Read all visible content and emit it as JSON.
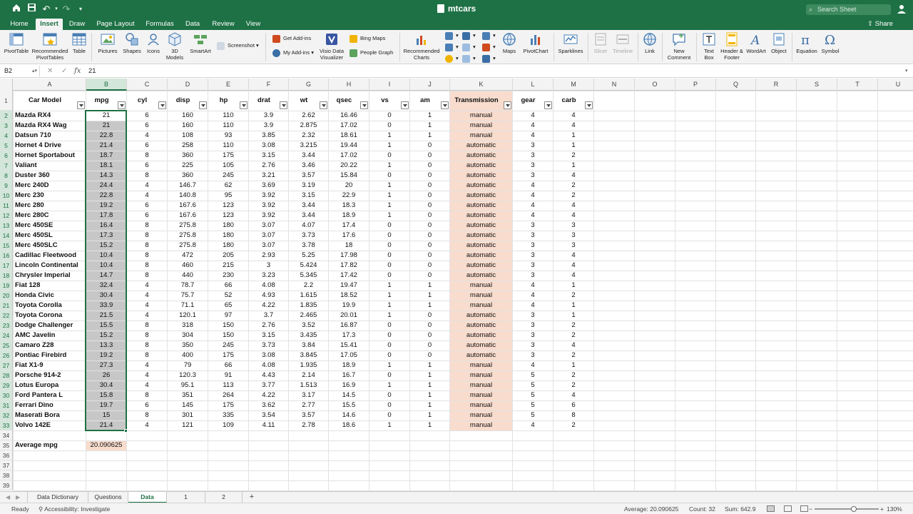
{
  "title_bar": {
    "document_title": "mtcars",
    "search_placeholder": "Search Sheet",
    "icons": [
      "home-icon",
      "save-icon",
      "undo-icon",
      "redo-icon",
      "customize-icon",
      "file-icon",
      "profile-icon"
    ]
  },
  "menu": {
    "tabs": [
      "Home",
      "Insert",
      "Draw",
      "Page Layout",
      "Formulas",
      "Data",
      "Review",
      "View"
    ],
    "active_tab": "Insert",
    "share_label": "Share"
  },
  "ribbon": {
    "pivot_table": "PivotTable",
    "recommended_pivot_1": "Recommended",
    "recommended_pivot_2": "PivotTables",
    "table": "Table",
    "pictures": "Pictures",
    "shapes": "Shapes",
    "icons": "Icons",
    "models_1": "3D",
    "models_2": "Models",
    "smartart": "SmartArt",
    "screenshot": "Screenshot",
    "get_addins": "Get Add-ins",
    "my_addins": "My Add-ins",
    "visio_1": "Visio Data",
    "visio_2": "Visualizer",
    "bing_maps": "Bing Maps",
    "people_graph": "People Graph",
    "rec_charts_1": "Recommended",
    "rec_charts_2": "Charts",
    "maps": "Maps",
    "pivot_chart": "PivotChart",
    "sparklines": "Sparklines",
    "slicer": "Slicer",
    "timeline": "Timeline",
    "link": "Link",
    "new_comment_1": "New",
    "new_comment_2": "Comment",
    "text_box_1": "Text",
    "text_box_2": "Box",
    "header_footer_1": "Header &",
    "header_footer_2": "Footer",
    "wordart": "WordArt",
    "object": "Object",
    "equation": "Equation",
    "symbol": "Symbol"
  },
  "formula_bar": {
    "name_box": "B2",
    "fx_label": "fx",
    "formula": "21"
  },
  "grid": {
    "column_letters": [
      "A",
      "B",
      "C",
      "D",
      "E",
      "F",
      "G",
      "H",
      "I",
      "J",
      "K",
      "L",
      "M",
      "N",
      "O",
      "P",
      "Q",
      "R",
      "S",
      "T",
      "U"
    ],
    "row_numbers": [
      "1",
      "2",
      "3",
      "4",
      "5",
      "6",
      "7",
      "8",
      "9",
      "10",
      "11",
      "12",
      "13",
      "14",
      "15",
      "16",
      "17",
      "18",
      "19",
      "20",
      "21",
      "22",
      "23",
      "24",
      "25",
      "26",
      "27",
      "28",
      "29",
      "30",
      "31",
      "32",
      "33",
      "34",
      "35",
      "36",
      "37",
      "38",
      "39"
    ],
    "headers": [
      "Car Model",
      "mpg",
      "cyl",
      "disp",
      "hp",
      "drat",
      "wt",
      "qsec",
      "vs",
      "am",
      "Transmission",
      "gear",
      "carb"
    ],
    "rows": [
      [
        "Mazda RX4",
        "21",
        "6",
        "160",
        "110",
        "3.9",
        "2.62",
        "16.46",
        "0",
        "1",
        "manual",
        "4",
        "4"
      ],
      [
        "Mazda RX4 Wag",
        "21",
        "6",
        "160",
        "110",
        "3.9",
        "2.875",
        "17.02",
        "0",
        "1",
        "manual",
        "4",
        "4"
      ],
      [
        "Datsun 710",
        "22.8",
        "4",
        "108",
        "93",
        "3.85",
        "2.32",
        "18.61",
        "1",
        "1",
        "manual",
        "4",
        "1"
      ],
      [
        "Hornet 4 Drive",
        "21.4",
        "6",
        "258",
        "110",
        "3.08",
        "3.215",
        "19.44",
        "1",
        "0",
        "automatic",
        "3",
        "1"
      ],
      [
        "Hornet Sportabout",
        "18.7",
        "8",
        "360",
        "175",
        "3.15",
        "3.44",
        "17.02",
        "0",
        "0",
        "automatic",
        "3",
        "2"
      ],
      [
        "Valiant",
        "18.1",
        "6",
        "225",
        "105",
        "2.76",
        "3.46",
        "20.22",
        "1",
        "0",
        "automatic",
        "3",
        "1"
      ],
      [
        "Duster 360",
        "14.3",
        "8",
        "360",
        "245",
        "3.21",
        "3.57",
        "15.84",
        "0",
        "0",
        "automatic",
        "3",
        "4"
      ],
      [
        "Merc 240D",
        "24.4",
        "4",
        "146.7",
        "62",
        "3.69",
        "3.19",
        "20",
        "1",
        "0",
        "automatic",
        "4",
        "2"
      ],
      [
        "Merc 230",
        "22.8",
        "4",
        "140.8",
        "95",
        "3.92",
        "3.15",
        "22.9",
        "1",
        "0",
        "automatic",
        "4",
        "2"
      ],
      [
        "Merc 280",
        "19.2",
        "6",
        "167.6",
        "123",
        "3.92",
        "3.44",
        "18.3",
        "1",
        "0",
        "automatic",
        "4",
        "4"
      ],
      [
        "Merc 280C",
        "17.8",
        "6",
        "167.6",
        "123",
        "3.92",
        "3.44",
        "18.9",
        "1",
        "0",
        "automatic",
        "4",
        "4"
      ],
      [
        "Merc 450SE",
        "16.4",
        "8",
        "275.8",
        "180",
        "3.07",
        "4.07",
        "17.4",
        "0",
        "0",
        "automatic",
        "3",
        "3"
      ],
      [
        "Merc 450SL",
        "17.3",
        "8",
        "275.8",
        "180",
        "3.07",
        "3.73",
        "17.6",
        "0",
        "0",
        "automatic",
        "3",
        "3"
      ],
      [
        "Merc 450SLC",
        "15.2",
        "8",
        "275.8",
        "180",
        "3.07",
        "3.78",
        "18",
        "0",
        "0",
        "automatic",
        "3",
        "3"
      ],
      [
        "Cadillac Fleetwood",
        "10.4",
        "8",
        "472",
        "205",
        "2.93",
        "5.25",
        "17.98",
        "0",
        "0",
        "automatic",
        "3",
        "4"
      ],
      [
        "Lincoln Continental",
        "10.4",
        "8",
        "460",
        "215",
        "3",
        "5.424",
        "17.82",
        "0",
        "0",
        "automatic",
        "3",
        "4"
      ],
      [
        "Chrysler Imperial",
        "14.7",
        "8",
        "440",
        "230",
        "3.23",
        "5.345",
        "17.42",
        "0",
        "0",
        "automatic",
        "3",
        "4"
      ],
      [
        "Fiat 128",
        "32.4",
        "4",
        "78.7",
        "66",
        "4.08",
        "2.2",
        "19.47",
        "1",
        "1",
        "manual",
        "4",
        "1"
      ],
      [
        "Honda Civic",
        "30.4",
        "4",
        "75.7",
        "52",
        "4.93",
        "1.615",
        "18.52",
        "1",
        "1",
        "manual",
        "4",
        "2"
      ],
      [
        "Toyota Corolla",
        "33.9",
        "4",
        "71.1",
        "65",
        "4.22",
        "1.835",
        "19.9",
        "1",
        "1",
        "manual",
        "4",
        "1"
      ],
      [
        "Toyota Corona",
        "21.5",
        "4",
        "120.1",
        "97",
        "3.7",
        "2.465",
        "20.01",
        "1",
        "0",
        "automatic",
        "3",
        "1"
      ],
      [
        "Dodge Challenger",
        "15.5",
        "8",
        "318",
        "150",
        "2.76",
        "3.52",
        "16.87",
        "0",
        "0",
        "automatic",
        "3",
        "2"
      ],
      [
        "AMC Javelin",
        "15.2",
        "8",
        "304",
        "150",
        "3.15",
        "3.435",
        "17.3",
        "0",
        "0",
        "automatic",
        "3",
        "2"
      ],
      [
        "Camaro Z28",
        "13.3",
        "8",
        "350",
        "245",
        "3.73",
        "3.84",
        "15.41",
        "0",
        "0",
        "automatic",
        "3",
        "4"
      ],
      [
        "Pontiac Firebird",
        "19.2",
        "8",
        "400",
        "175",
        "3.08",
        "3.845",
        "17.05",
        "0",
        "0",
        "automatic",
        "3",
        "2"
      ],
      [
        "Fiat X1-9",
        "27.3",
        "4",
        "79",
        "66",
        "4.08",
        "1.935",
        "18.9",
        "1",
        "1",
        "manual",
        "4",
        "1"
      ],
      [
        "Porsche 914-2",
        "26",
        "4",
        "120.3",
        "91",
        "4.43",
        "2.14",
        "16.7",
        "0",
        "1",
        "manual",
        "5",
        "2"
      ],
      [
        "Lotus Europa",
        "30.4",
        "4",
        "95.1",
        "113",
        "3.77",
        "1.513",
        "16.9",
        "1",
        "1",
        "manual",
        "5",
        "2"
      ],
      [
        "Ford Pantera L",
        "15.8",
        "8",
        "351",
        "264",
        "4.22",
        "3.17",
        "14.5",
        "0",
        "1",
        "manual",
        "5",
        "4"
      ],
      [
        "Ferrari Dino",
        "19.7",
        "6",
        "145",
        "175",
        "3.62",
        "2.77",
        "15.5",
        "0",
        "1",
        "manual",
        "5",
        "6"
      ],
      [
        "Maserati Bora",
        "15",
        "8",
        "301",
        "335",
        "3.54",
        "3.57",
        "14.6",
        "0",
        "1",
        "manual",
        "5",
        "8"
      ],
      [
        "Volvo 142E",
        "21.4",
        "4",
        "121",
        "109",
        "4.11",
        "2.78",
        "18.6",
        "1",
        "1",
        "manual",
        "4",
        "2"
      ]
    ],
    "average_label": "Average mpg",
    "average_value": "20.090625",
    "colors": {
      "mpg_shade": "#c7c7c7",
      "transmission_shade": "#f8dccd",
      "accent": "#1e7145"
    }
  },
  "sheet_tabs": {
    "tabs": [
      "Data Dictionary",
      "Questions",
      "Data",
      "1",
      "2"
    ],
    "active": "Data",
    "add_label": "+"
  },
  "status_bar": {
    "ready": "Ready",
    "accessibility": "Accessibility: Investigate",
    "average": "Average: 20.090625",
    "count": "Count: 32",
    "sum": "Sum: 642.9",
    "zoom": "130%",
    "zoom_minus": "−",
    "zoom_plus": "+"
  }
}
